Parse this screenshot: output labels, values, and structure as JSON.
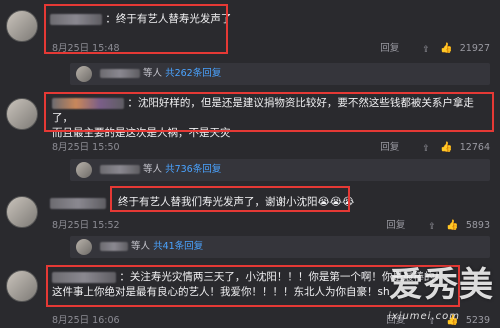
{
  "comments": [
    {
      "text": "：终于有艺人替寿光发声了",
      "time": "8月25日 15:48",
      "reply_label": "回复",
      "likes": "21927",
      "sub": {
        "prefix": "等人",
        "count": "共262条回复"
      }
    },
    {
      "text_line1": "：沈阳好样的，但是还是建议捐物资比较好，要不然这些钱都被关系户拿走了，",
      "text_line2": "而且最主要的是这次是人祸，不是天灾",
      "time": "8月25日 15:50",
      "reply_label": "回复",
      "likes": "12764",
      "sub": {
        "prefix": "等人",
        "count": "共736条回复"
      }
    },
    {
      "text": "终于有艺人替我们寿光发声了，谢谢小沈阳😭😭😭",
      "time": "8月25日 15:52",
      "reply_label": "回复",
      "likes": "5893",
      "sub": {
        "prefix": "等人",
        "count": "共41条回复"
      }
    },
    {
      "text_line1": "：关注寿光灾情两三天了，小沈阳！！！你是第一个啊！你是最棒的！",
      "text_line2": "这件事上你绝对是最有良心的艺人！我爱你！！！！东北人为你自豪！sh",
      "time": "8月25日 16:06",
      "reply_label": "回复",
      "likes": "5239"
    }
  ],
  "watermark": {
    "brand": "爱秀美",
    "url": "ixiumei.com"
  },
  "colors": {
    "highlight": "#e53935",
    "link": "#4aa3ff",
    "background": "#2a2a2e"
  }
}
